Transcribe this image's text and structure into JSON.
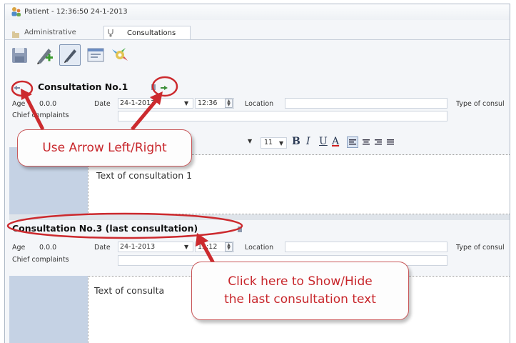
{
  "window": {
    "title": "Patient - 12:36:50 24-1-2013"
  },
  "tabs": [
    {
      "label": "Administrative"
    },
    {
      "label": "Consultations"
    }
  ],
  "toolbar": {
    "buttons": [
      "save-icon",
      "new-consultation-icon",
      "edit-icon",
      "view-icon",
      "tools-icon"
    ]
  },
  "consult1": {
    "header": "Consultation No.1",
    "age_label": "Age",
    "age_value": "0.0.0",
    "date_label": "Date",
    "date_value": "24-1-2013",
    "time_value": "12:36",
    "location_label": "Location",
    "type_label": "Type of consul",
    "chief_label": "Chief complaints",
    "font_size": "11",
    "text": "Text of consultation 1"
  },
  "consult3": {
    "header": "Consultation No.3 (last consultation)",
    "age_label": "Age",
    "age_value": "0.0.0",
    "date_label": "Date",
    "date_value": "24-1-2013",
    "time_value": "15:12",
    "location_label": "Location",
    "type_label": "Type of consul",
    "chief_label": "Chief complaints",
    "text": "Text of consulta"
  },
  "callouts": {
    "arrows": "Use Arrow Left/Right",
    "show_hide_line1": "Click here to Show/Hide",
    "show_hide_line2": "the last consultation text"
  },
  "colors": {
    "annotation": "#cc2a2e",
    "callout_text": "#c8272c"
  }
}
